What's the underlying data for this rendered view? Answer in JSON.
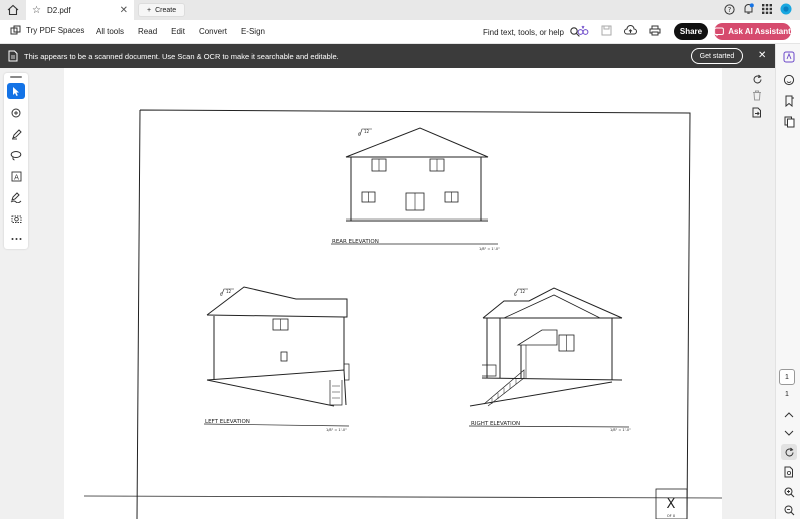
{
  "tabbar": {
    "tab_title": "D2.pdf",
    "create_label": "Create"
  },
  "toolbar": {
    "spaces_label": "Try PDF Spaces",
    "menu": [
      "All tools",
      "Read",
      "Edit",
      "Convert",
      "E-Sign"
    ],
    "find_label": "Find text, tools, or help",
    "share_label": "Share",
    "ai_label": "Ask AI Assistant"
  },
  "banner": {
    "message": "This appears to be a scanned document. Use Scan & OCR to make it searchable and editable.",
    "cta": "Get started"
  },
  "drawing": {
    "rear_label": "REAR ELEVATION",
    "rear_scale": "1/8\" = 1'-0\"",
    "left_label": "LEFT ELEVATION",
    "left_scale": "1/8\" = 1'-0\"",
    "right_label": "RIGHT ELEVATION",
    "right_scale": "1/8\" = 1'-0\"",
    "pitch_number": "12",
    "pitch_rise": "6",
    "sheet_mark": "X",
    "sheet_sub": "OF X"
  },
  "pagination": {
    "current": "1",
    "total": "1"
  },
  "colors": {
    "accent": "#1473e6",
    "ai": "#d64b6e",
    "banner": "#3b3b3b"
  }
}
